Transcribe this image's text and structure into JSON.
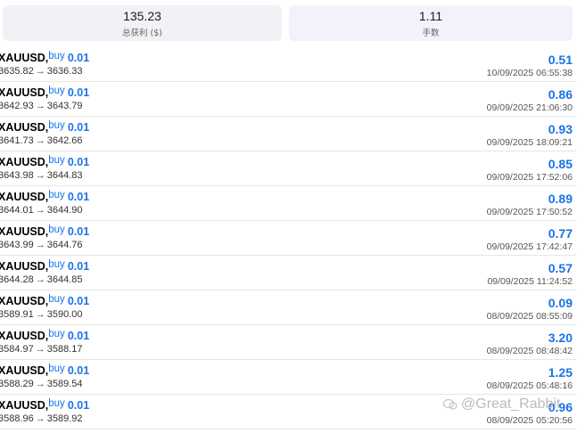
{
  "summary": {
    "profit_value": "135.23",
    "profit_label": "总获利 ($)",
    "lots_value": "1.11",
    "lots_label": "手数"
  },
  "trades": [
    {
      "symbol": "XAUUSD,",
      "side": "buy",
      "lot": "0.01",
      "open": "3635.82",
      "close": "3636.33",
      "profit": "0.51",
      "time": "10/09/2025 06:55:38"
    },
    {
      "symbol": "XAUUSD,",
      "side": "buy",
      "lot": "0.01",
      "open": "3642.93",
      "close": "3643.79",
      "profit": "0.86",
      "time": "09/09/2025 21:06:30"
    },
    {
      "symbol": "XAUUSD,",
      "side": "buy",
      "lot": "0.01",
      "open": "3641.73",
      "close": "3642.66",
      "profit": "0.93",
      "time": "09/09/2025 18:09:21"
    },
    {
      "symbol": "XAUUSD,",
      "side": "buy",
      "lot": "0.01",
      "open": "3643.98",
      "close": "3644.83",
      "profit": "0.85",
      "time": "09/09/2025 17:52:06"
    },
    {
      "symbol": "XAUUSD,",
      "side": "buy",
      "lot": "0.01",
      "open": "3644.01",
      "close": "3644.90",
      "profit": "0.89",
      "time": "09/09/2025 17:50:52"
    },
    {
      "symbol": "XAUUSD,",
      "side": "buy",
      "lot": "0.01",
      "open": "3643.99",
      "close": "3644.76",
      "profit": "0.77",
      "time": "09/09/2025 17:42:47"
    },
    {
      "symbol": "XAUUSD,",
      "side": "buy",
      "lot": "0.01",
      "open": "3644.28",
      "close": "3644.85",
      "profit": "0.57",
      "time": "09/09/2025 11:24:52"
    },
    {
      "symbol": "XAUUSD,",
      "side": "buy",
      "lot": "0.01",
      "open": "3589.91",
      "close": "3590.00",
      "profit": "0.09",
      "time": "08/09/2025 08:55:09"
    },
    {
      "symbol": "XAUUSD,",
      "side": "buy",
      "lot": "0.01",
      "open": "3584.97",
      "close": "3588.17",
      "profit": "3.20",
      "time": "08/09/2025 08:48:42"
    },
    {
      "symbol": "XAUUSD,",
      "side": "buy",
      "lot": "0.01",
      "open": "3588.29",
      "close": "3589.54",
      "profit": "1.25",
      "time": "08/09/2025 05:48:16"
    },
    {
      "symbol": "XAUUSD,",
      "side": "buy",
      "lot": "0.01",
      "open": "3588.96",
      "close": "3589.92",
      "profit": "0.96",
      "time": "08/09/2025 05:20:56"
    }
  ],
  "arrow_glyph": "→",
  "watermark": "@Great_Rabbit",
  "colors": {
    "accent": "#1a73e8",
    "card_left": "#f1f2f6",
    "card_right": "#f5f1fb"
  }
}
